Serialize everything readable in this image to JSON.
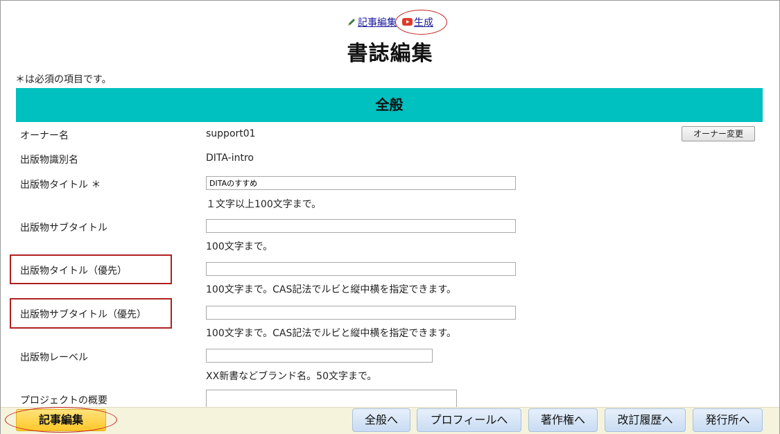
{
  "top_nav": {
    "edit_link": "記事編集",
    "generate_link": "生成"
  },
  "page_title": "書誌編集",
  "required_note": "＊は必須の項目です。",
  "section_general": "全般",
  "fields": {
    "owner": {
      "label": "オーナー名",
      "value": "support01",
      "button": "オーナー変更"
    },
    "identifier": {
      "label": "出版物識別名",
      "value": "DITA-intro"
    },
    "title": {
      "label": "出版物タイトル ＊",
      "value": "DITAのすすめ",
      "hint": "１文字以上100文字まで。"
    },
    "subtitle": {
      "label": "出版物サブタイトル",
      "value": "",
      "hint": "100文字まで。"
    },
    "title_pref": {
      "label": "出版物タイトル（優先）",
      "value": "",
      "hint": "100文字まで。CAS記法でルビと縦中横を指定できます。"
    },
    "subtitle_pref": {
      "label": "出版物サブタイトル（優先）",
      "value": "",
      "hint": "100文字まで。CAS記法でルビと縦中横を指定できます。"
    },
    "label": {
      "label": "出版物レーベル",
      "value": "",
      "hint": "XX新書などブランド名。50文字まで。"
    },
    "project_summary": {
      "label": "プロジェクトの概要",
      "value": ""
    }
  },
  "bottom_bar": {
    "edit_button": "記事編集",
    "nav": [
      "全般へ",
      "プロフィールへ",
      "著作権へ",
      "改訂履歴へ",
      "発行所へ"
    ]
  },
  "colors": {
    "section_header": "#00c0c0",
    "annotation_red": "#b02020",
    "primary_button": "#ffc82a",
    "nav_button": "#c9dcf3"
  }
}
